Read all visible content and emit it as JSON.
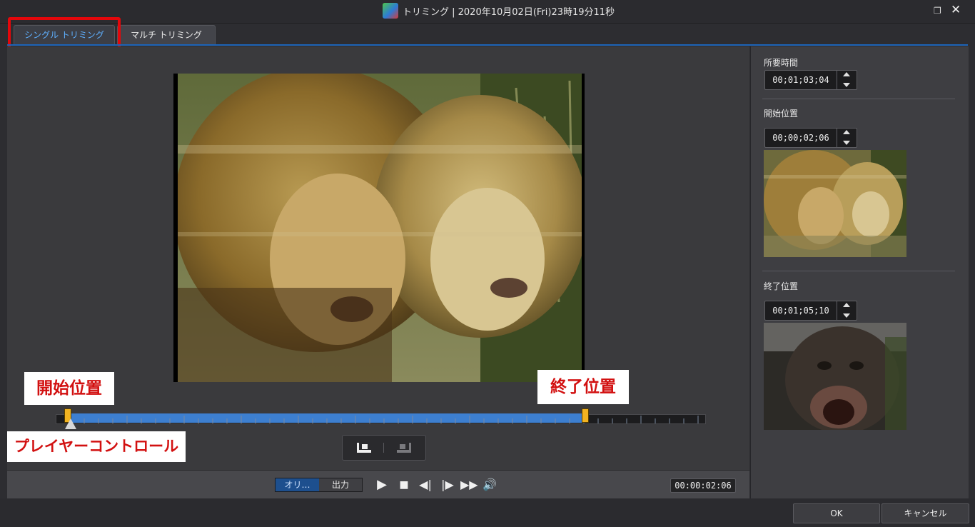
{
  "window": {
    "title": "トリミング | 2020年10月02日(Fri)23時19分11秒",
    "restore_icon": "restore-icon",
    "close_icon": "close-icon"
  },
  "tabs": [
    {
      "label": "シングル トリミング",
      "active": true
    },
    {
      "label": "マルチ トリミング",
      "active": false
    }
  ],
  "annotations": {
    "start_label": "開始位置",
    "end_label": "終了位置",
    "player_label": "プレイヤーコントロール",
    "highlight_color": "#e4070b"
  },
  "timeline": {
    "selected_color": "#3d7fd0",
    "marker_color": "#f2b321"
  },
  "transport": {
    "mode_original": "オリ…",
    "mode_output": "出力",
    "play_icon": "play-icon",
    "stop_icon": "stop-icon",
    "prev_frame_icon": "prev-frame-icon",
    "next_frame_icon": "next-frame-icon",
    "fast_forward_icon": "fast-forward-icon",
    "volume_icon": "volume-icon",
    "current_time": "00:00:02:06"
  },
  "right_panel": {
    "duration_label": "所要時間",
    "duration_value": "00;01;03;04",
    "start_label": "開始位置",
    "start_value": "00;00;02;06",
    "end_label": "終了位置",
    "end_value": "00;01;05;10"
  },
  "buttons": {
    "ok": "OK",
    "cancel": "キャンセル"
  },
  "colors": {
    "accent": "#1d64b8",
    "background": "#3a3a3d"
  }
}
